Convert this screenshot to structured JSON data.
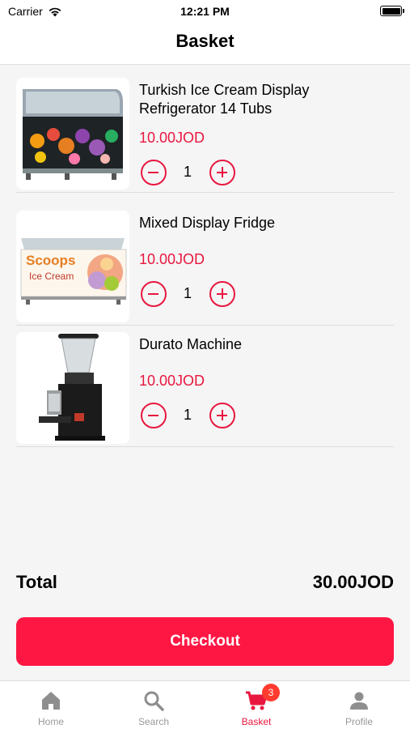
{
  "status_bar": {
    "carrier": "Carrier",
    "time": "12:21 PM"
  },
  "header": {
    "title": "Basket"
  },
  "items": [
    {
      "name": "Turkish Ice Cream Display Refrigerator 14 Tubs",
      "price": "10.00JOD",
      "quantity": "1"
    },
    {
      "name": "Mixed Display Fridge",
      "price": "10.00JOD",
      "quantity": "1",
      "image_text": {
        "brand": "Scoops",
        "sub": "Ice Cream"
      }
    },
    {
      "name": "Durato Machine",
      "price": "10.00JOD",
      "quantity": "1"
    }
  ],
  "summary": {
    "total_label": "Total",
    "total_value": "30.00JOD"
  },
  "checkout": {
    "label": "Checkout"
  },
  "tab_bar": {
    "tabs": [
      {
        "label": "Home",
        "icon": "home-icon"
      },
      {
        "label": "Search",
        "icon": "search-icon"
      },
      {
        "label": "Basket",
        "icon": "cart-icon",
        "badge": "3",
        "active": true
      },
      {
        "label": "Profile",
        "icon": "person-icon"
      }
    ]
  },
  "colors": {
    "accent": "#ff1744",
    "price": "#e8173f",
    "badge": "#ff3b30",
    "inactive_tab": "#999999"
  }
}
